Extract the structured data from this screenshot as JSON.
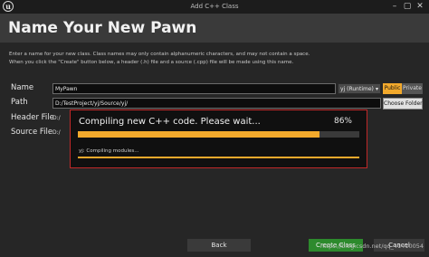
{
  "window": {
    "title": "Add C++ Class",
    "controls": [
      "–",
      "▢",
      "✕"
    ]
  },
  "header": {
    "title": "Name Your New Pawn"
  },
  "description": {
    "line1": "Enter a name for your new class. Class names may only contain alphanumeric characters, and may not contain a space.",
    "line2": "When you click the \"Create\" button below, a header (.h) file and a source (.cpp) file will be made using this name."
  },
  "form": {
    "name_label": "Name",
    "name_value": "MyPawn",
    "module_select": "yj (Runtime)",
    "public_label": "Public",
    "private_label": "Private",
    "path_label": "Path",
    "path_value": "D:/TestProject/yj/Source/yj/",
    "choose_folder_label": "Choose Folder",
    "header_file_label": "Header File",
    "header_file_value": "D:/",
    "source_file_label": "Source File",
    "source_file_value": "D:/"
  },
  "progress_dialog": {
    "title": "Compiling new C++ code.  Please wait...",
    "percent_text": "86%",
    "percent": 86,
    "subtask": "yj: Compiling modules...",
    "subtask_percent": 100
  },
  "footer": {
    "back_label": "Back",
    "create_label": "Create Class",
    "cancel_label": "Cancel"
  },
  "watermark": "https://blog.csdn.net/qq_41410054",
  "colors": {
    "accent": "#f2a92c",
    "create": "#2d8a2d",
    "dialog_border": "#c02828"
  }
}
